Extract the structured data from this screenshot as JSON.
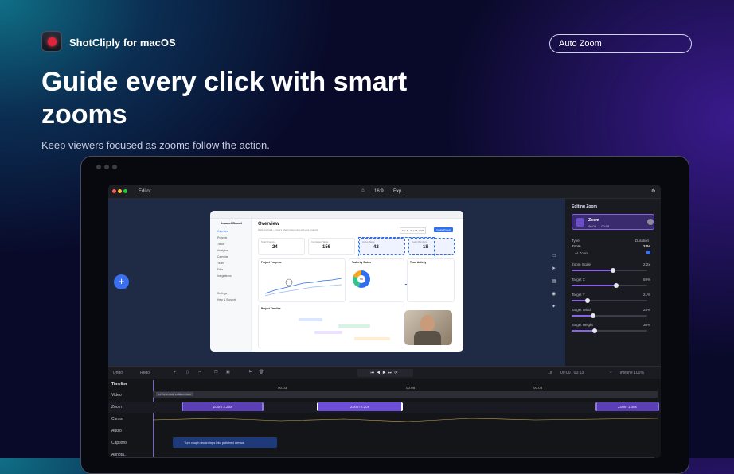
{
  "app": {
    "name": "ShotCliply for macOS",
    "badge": "Auto Zoom"
  },
  "hero": {
    "title": "Guide every click with smart zooms",
    "subtitle": "Keep viewers focused as zooms follow the action."
  },
  "editor": {
    "title": "Editor",
    "zoom_menu": "16:9",
    "export": "Exp...",
    "panel": {
      "title": "Editing Zoom",
      "item_name": "Zoom",
      "item_time": "00:03 — 00:05",
      "type_label": "Type",
      "duration_label": "Duration",
      "type_value": "Zoom",
      "duration_value": "2.0s",
      "ai_zoom": "AI Zoom",
      "sliders": [
        {
          "label": "Zoom Scale",
          "value": "2.2x",
          "level": 0.55
        },
        {
          "label": "Target X",
          "value": "59%",
          "level": 0.59
        },
        {
          "label": "Target Y",
          "value": "21%",
          "level": 0.21
        },
        {
          "label": "Target Width",
          "value": "28%",
          "level": 0.28
        },
        {
          "label": "Target Height",
          "value": "30%",
          "level": 0.3
        }
      ]
    },
    "toolbar": {
      "undo": "Undo",
      "redo": "Redo",
      "speed": "1x",
      "timecode": "00:00 / 00:13",
      "timeline_zoom": "Timeline 100%"
    },
    "timeline": {
      "title": "Timeline",
      "ticks": [
        "00:03",
        "00:05",
        "00:08"
      ],
      "tracks": [
        {
          "name": "Video"
        },
        {
          "name": "Zoom"
        },
        {
          "name": "Cursor"
        },
        {
          "name": "Audio"
        },
        {
          "name": "Captions"
        },
        {
          "name": "Annota..."
        }
      ],
      "video_clip": "review-main-video.mov",
      "zoom_clips": [
        "Zoom 2.20x",
        "Zoom 2.20x",
        "Zoom 1.00x"
      ],
      "caption": "Turn rough recordings into polished demos"
    }
  },
  "screenshot": {
    "title": "Overview",
    "subtitle": "Welcome back — here's what's happening with your projects.",
    "brand": "LaunchBoard",
    "date_range": "Sep 9 – Sep 16, 2025",
    "new_button": "Create Project",
    "nav": [
      "Overview",
      "Projects",
      "Tasks",
      "Analytics",
      "Calendar",
      "Team",
      "Files",
      "Integrations",
      "Settings",
      "Help & Support"
    ],
    "stats": [
      {
        "label": "Total Projects",
        "value": "24"
      },
      {
        "label": "Completed Tasks",
        "value": "156"
      },
      {
        "label": "Active Tasks",
        "value": "42"
      },
      {
        "label": "Team Members",
        "value": "18"
      }
    ],
    "progress_title": "Project Progress",
    "tasks_title": "Tasks by Status",
    "activity_title": "Team Activity",
    "timeline_title": "Project Timeline",
    "donut_value": "90"
  },
  "colors": {
    "accent": "#8a62e8",
    "clip": "#5b3fb5",
    "brand_blue": "#2f6fed"
  }
}
